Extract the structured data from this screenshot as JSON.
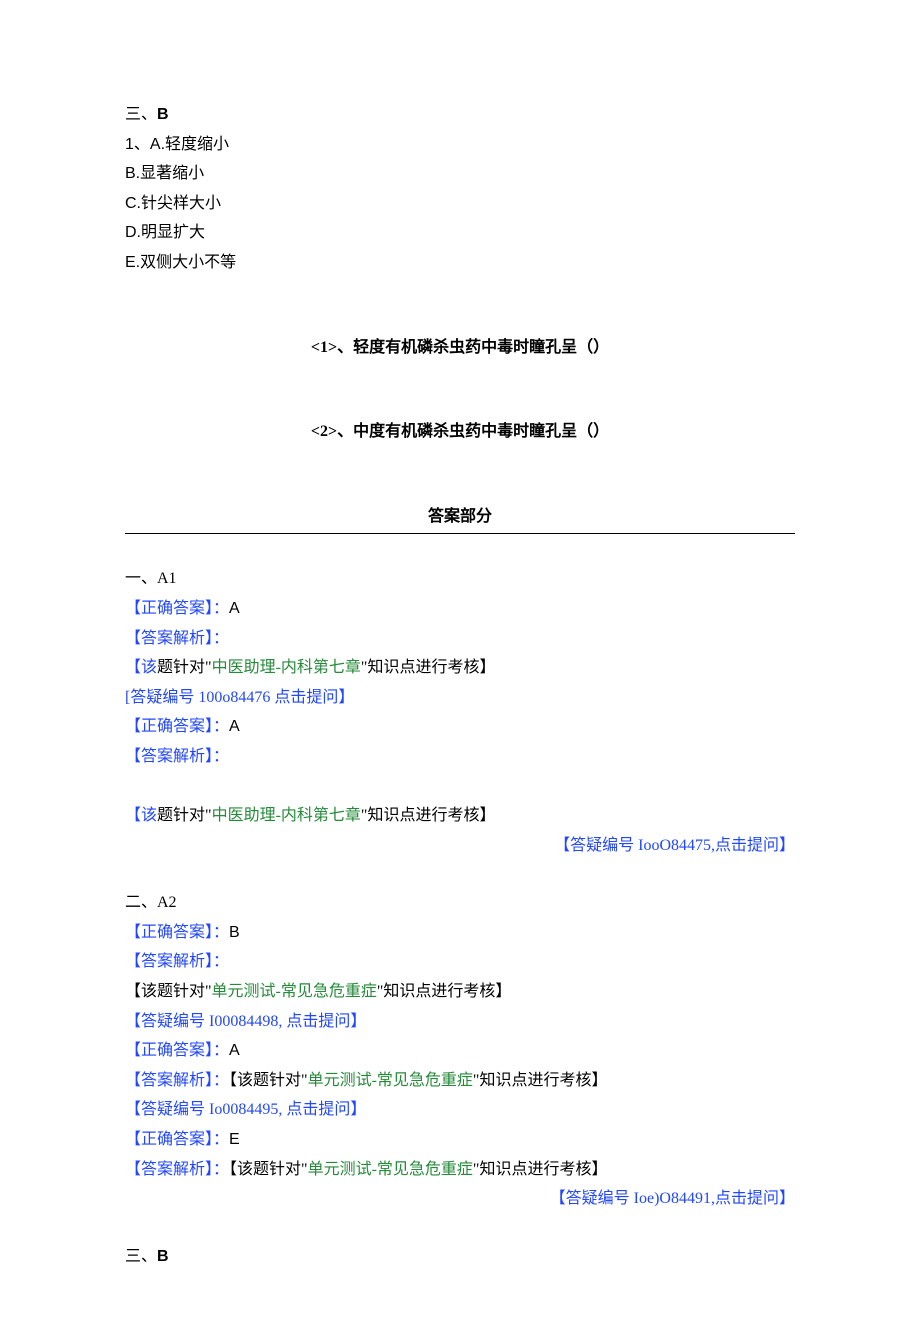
{
  "section3": {
    "header_prefix": "三、",
    "header_letter": "B",
    "q1_number": "1、",
    "options": {
      "a_prefix": "A.",
      "a_text": "轻度缩小",
      "b": "B.显著缩小",
      "c": "C.针尖样大小",
      "d": "D.明显扩大",
      "e": "E.双侧大小不等"
    },
    "sub1": "<1>、轻度有机磷杀虫药中毒时瞳孔呈（）",
    "sub2": "<2>、中度有机磷杀虫药中毒时瞳孔呈（）"
  },
  "answers_header": "答案部分",
  "sectionA1": {
    "heading": "一、A1",
    "correct_label": "【正确答案】：",
    "correct_value_1": "A",
    "analysis_label": "【答案解析】：",
    "topic_prefix": "【该",
    "topic_mid": "题针对\"",
    "topic_green": "中医助理-内科第七章",
    "topic_suffix": "\"知识点进行考核】",
    "faq1": "[答疑编号 100o84476 点击提问】",
    "correct_value_2": "A",
    "faq2": "【答疑编号 IooO84475,点击提问】"
  },
  "sectionA2": {
    "heading": "二、A2",
    "correct_label": "【正确答案】：",
    "correct_value_1": "B",
    "analysis_label": "【答案解析】：",
    "topic_prefix": "【该题针对\"",
    "topic_green": "单元测试-常见急危重症",
    "topic_suffix": "\"知识点进行考核】",
    "faq1": "【答疑编号 I00084498, 点击提问】",
    "correct_value_2": "A",
    "topic2_prefix": "【该题针对\"",
    "faq2": "【答疑编号 Io0084495, 点击提问】",
    "correct_value_3": "E",
    "faq3": "【答疑编号 Ioe)O84491,点击提问】"
  },
  "section3b": {
    "header_prefix": "三、",
    "header_letter": "B"
  }
}
